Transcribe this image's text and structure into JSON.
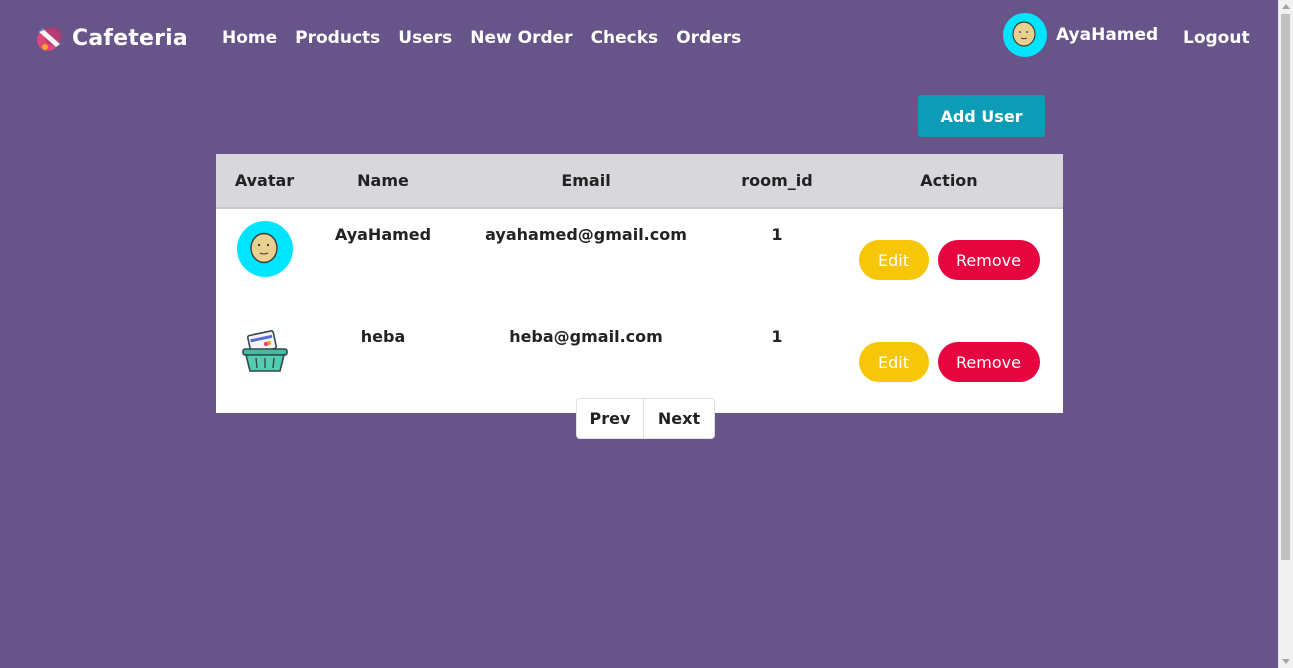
{
  "brand": {
    "name": "Cafeteria",
    "logo_icon": "rocket-logo-icon"
  },
  "nav": {
    "items": [
      {
        "label": "Home"
      },
      {
        "label": "Products"
      },
      {
        "label": "Users"
      },
      {
        "label": "New Order"
      },
      {
        "label": "Checks"
      },
      {
        "label": "Orders"
      }
    ],
    "user": {
      "name": "AyaHamed",
      "avatar_icon": "face-avatar-icon"
    },
    "logout_label": "Logout"
  },
  "actions": {
    "add_user_label": "Add User"
  },
  "table": {
    "headers": [
      "Avatar",
      "Name",
      "Email",
      "room_id",
      "Action"
    ],
    "rows": [
      {
        "avatar_icon": "face-avatar-icon",
        "name": "AyaHamed",
        "email": "ayahamed@gmail.com",
        "room_id": "1",
        "edit_label": "Edit",
        "remove_label": "Remove"
      },
      {
        "avatar_icon": "shopping-basket-icon",
        "name": "heba",
        "email": "heba@gmail.com",
        "room_id": "1",
        "edit_label": "Edit",
        "remove_label": "Remove"
      }
    ]
  },
  "pagination": {
    "prev_label": "Prev",
    "next_label": "Next"
  },
  "colors": {
    "background": "#675489",
    "accent": "#0d9cb5",
    "edit": "#f8c609",
    "remove": "#e6053f",
    "header_row": "#d8d8dc"
  }
}
